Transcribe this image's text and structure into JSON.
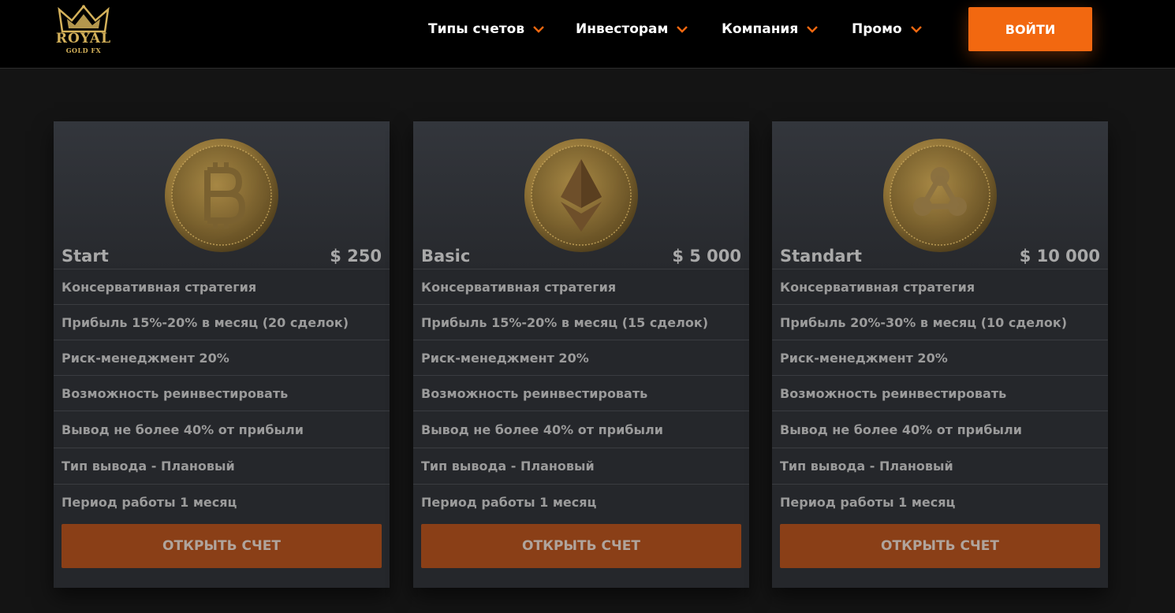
{
  "logo": {
    "line1": "ROYAL",
    "line2": "GOLD FX"
  },
  "nav": [
    {
      "label": "Типы счетов"
    },
    {
      "label": "Инвесторам"
    },
    {
      "label": "Компания"
    },
    {
      "label": "Промо"
    }
  ],
  "login_label": "ВОЙТИ",
  "colors": {
    "accent": "#f26810",
    "card_button": "#8a3f17",
    "coin": "#b8964e"
  },
  "plans": [
    {
      "coin_icon": "bitcoin-coin-icon",
      "name": "Start",
      "price": "$ 250",
      "features": [
        "Консервативная стратегия",
        "Прибыль 15%-20% в месяц (20 сделок)",
        "Риск-менеджмент 20%",
        "Возможность реинвестировать",
        "Вывод не более 40% от прибыли",
        "Тип вывода - Плановый",
        "Период работы 1 месяц"
      ],
      "button": "ОТКРЫТЬ СЧЕТ"
    },
    {
      "coin_icon": "ethereum-coin-icon",
      "name": "Basic",
      "price": "$ 5 000",
      "features": [
        "Консервативная стратегия",
        "Прибыль 15%-20% в месяц (15 сделок)",
        "Риск-менеджмент 20%",
        "Возможность реинвестировать",
        "Вывод не более 40% от прибыли",
        "Тип вывода - Плановый",
        "Период работы 1 месяц"
      ],
      "button": "ОТКРЫТЬ СЧЕТ"
    },
    {
      "coin_icon": "ripple-coin-icon",
      "name": "Standart",
      "price": "$ 10 000",
      "features": [
        "Консервативная стратегия",
        "Прибыль 20%-30% в месяц (10 сделок)",
        "Риск-менеджмент 20%",
        "Возможность реинвестировать",
        "Вывод не более 40% от прибыли",
        "Тип вывода - Плановый",
        "Период работы 1 месяц"
      ],
      "button": "ОТКРЫТЬ СЧЕТ"
    }
  ]
}
